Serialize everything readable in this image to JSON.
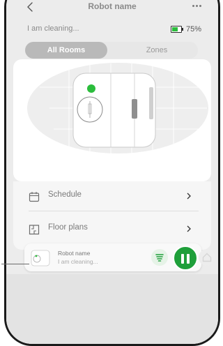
{
  "header": {
    "title": "Robot name"
  },
  "status": {
    "text": "I am cleaning...",
    "battery_percent": "75%",
    "battery_level": 0.75
  },
  "tabs": [
    {
      "label": "All Rooms",
      "active": true
    },
    {
      "label": "Zones",
      "active": false
    }
  ],
  "menu": [
    {
      "label": "Schedule",
      "icon": "calendar-icon"
    },
    {
      "label": "Floor plans",
      "icon": "floor-plan-icon"
    }
  ],
  "mini_player": {
    "name": "Robot name",
    "status": "I am cleaning...",
    "icons": [
      "fan-icon",
      "pause-icon",
      "home-icon"
    ]
  },
  "colors": {
    "accent": "#1e9f3a",
    "battery": "#2bbd3c",
    "tab_active": "#b9b9b9"
  }
}
